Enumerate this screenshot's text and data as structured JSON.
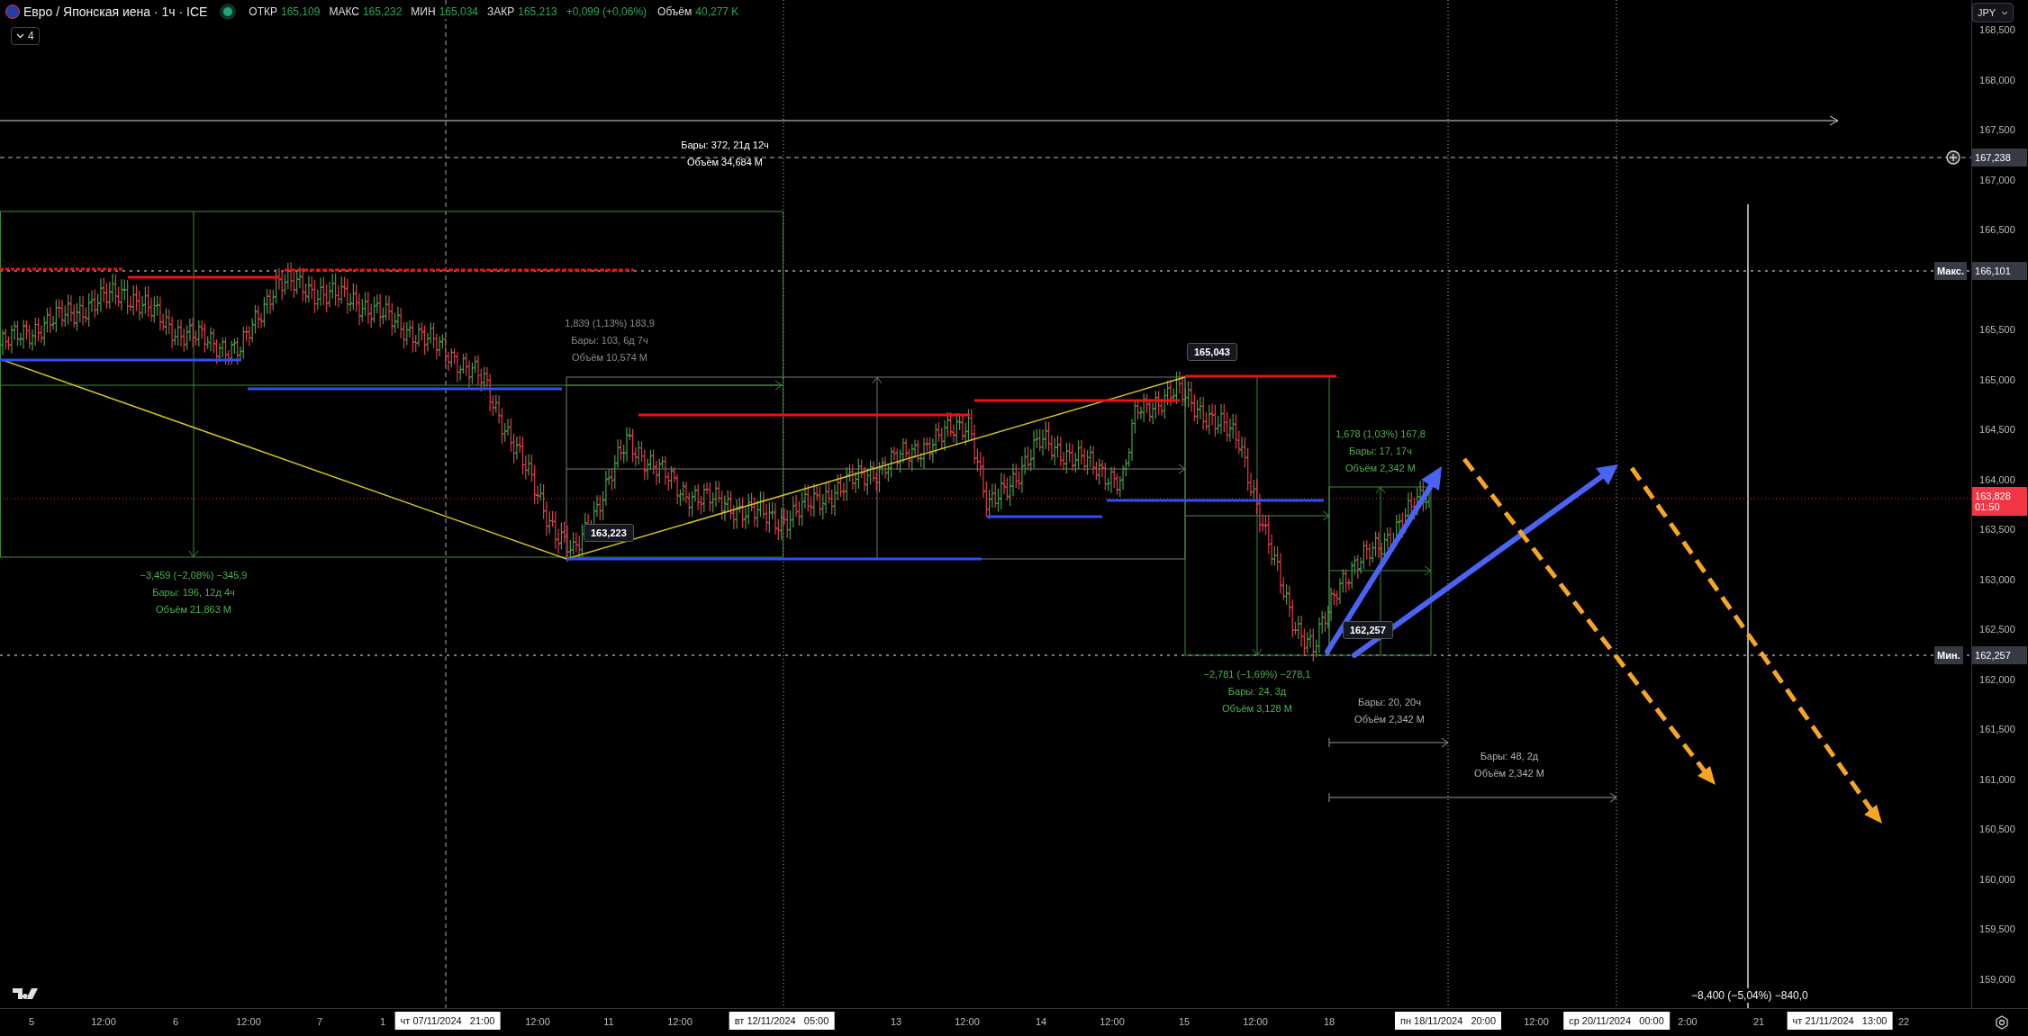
{
  "header": {
    "symbol": "Евро / Японская иена · 1ч · ICE",
    "ohlc": [
      {
        "label": "ОТКР",
        "value": "165,109"
      },
      {
        "label": "МАКС",
        "value": "165,232"
      },
      {
        "label": "МИН",
        "value": "165,034"
      },
      {
        "label": "ЗАКР",
        "value": "165,213"
      }
    ],
    "change": "+0,099 (+0,06%)",
    "volume_label": "Объём",
    "volume_value": "40,277 K",
    "indicators_button": "4"
  },
  "currency_button": "JPY",
  "price_axis": {
    "ticks": [
      "168,500",
      "168,000",
      "167,500",
      "167,000",
      "166,500",
      "165,500",
      "165,000",
      "164,500",
      "164,000",
      "163,500",
      "163,000",
      "162,500",
      "162,000",
      "161,500",
      "161,000",
      "160,500",
      "160,000",
      "159,500",
      "159,000"
    ],
    "markers": [
      {
        "kind": "alert",
        "label": "167,238"
      },
      {
        "kind": "max",
        "tag": "Макс.",
        "label": "166,101"
      },
      {
        "kind": "last",
        "label": "163,828",
        "timer": "01:50"
      },
      {
        "kind": "min",
        "tag": "Мин.",
        "label": "162,257"
      }
    ]
  },
  "annotations": [
    {
      "color": "#ffffff",
      "lines": [
        "Бары: 372, 21д 12ч",
        "Объём 34,684 M"
      ]
    },
    {
      "color": "#4caf50",
      "lines": [
        "−3,459 (−2,08%) −345,9",
        "Бары: 196, 12д 4ч",
        "Объём 21,863 M"
      ]
    },
    {
      "color": "#8a8a8a",
      "lines": [
        "1,839 (1,13%) 183,9",
        "Бары: 103, 6д 7ч",
        "Объём 10,574 M"
      ]
    },
    {
      "color": "#4caf50",
      "lines": [
        "1,678 (1,03%) 167,8",
        "Бары: 17, 17ч",
        "Объём 2,342 M"
      ]
    },
    {
      "color": "#4caf50",
      "lines": [
        "−2,781 (−1,69%) −278,1",
        "Бары: 24, 3д",
        "Объём 3,128 M"
      ]
    },
    {
      "color": "#b0b0b0",
      "lines": [
        "Бары: 20, 20ч",
        "Объём 2,342 M"
      ]
    },
    {
      "color": "#b0b0b0",
      "lines": [
        "Бары: 48, 2д",
        "Объём 2,342 M"
      ]
    }
  ],
  "price_callouts": [
    "163,223",
    "165,043",
    "162,257"
  ],
  "footer_measure": "−8,400 (−5,04%) −840,0",
  "time_axis": {
    "ticks": [
      {
        "kind": "tick",
        "label": "5"
      },
      {
        "kind": "tick",
        "label": "12:00"
      },
      {
        "kind": "tick",
        "label": "6"
      },
      {
        "kind": "tick",
        "label": "12:00"
      },
      {
        "kind": "tick",
        "label": "7"
      },
      {
        "kind": "tick",
        "label": "1"
      },
      {
        "kind": "cursor",
        "label": "чт 07/11/2024",
        "time": "21:00"
      },
      {
        "kind": "tick",
        "label": "12:00"
      },
      {
        "kind": "tick",
        "label": "11"
      },
      {
        "kind": "tick",
        "label": "12:00"
      },
      {
        "kind": "cursor",
        "label": "вт 12/11/2024",
        "time": "05:00"
      },
      {
        "kind": "tick",
        "label": "13"
      },
      {
        "kind": "tick",
        "label": "12:00"
      },
      {
        "kind": "tick",
        "label": "14"
      },
      {
        "kind": "tick",
        "label": "12:00"
      },
      {
        "kind": "tick",
        "label": "15"
      },
      {
        "kind": "tick",
        "label": "12:00"
      },
      {
        "kind": "tick",
        "label": "18"
      },
      {
        "kind": "cursor",
        "label": "пн 18/11/2024",
        "time": "20:00"
      },
      {
        "kind": "tick",
        "label": "12:00"
      },
      {
        "kind": "cursor",
        "label": "ср 20/11/2024",
        "time": "00:00"
      },
      {
        "kind": "tick",
        "label": "2:00"
      },
      {
        "kind": "tick",
        "label": "21"
      },
      {
        "kind": "cursor",
        "label": "чт 21/11/2024",
        "time": "13:00"
      },
      {
        "kind": "tick",
        "label": "22"
      }
    ]
  }
}
